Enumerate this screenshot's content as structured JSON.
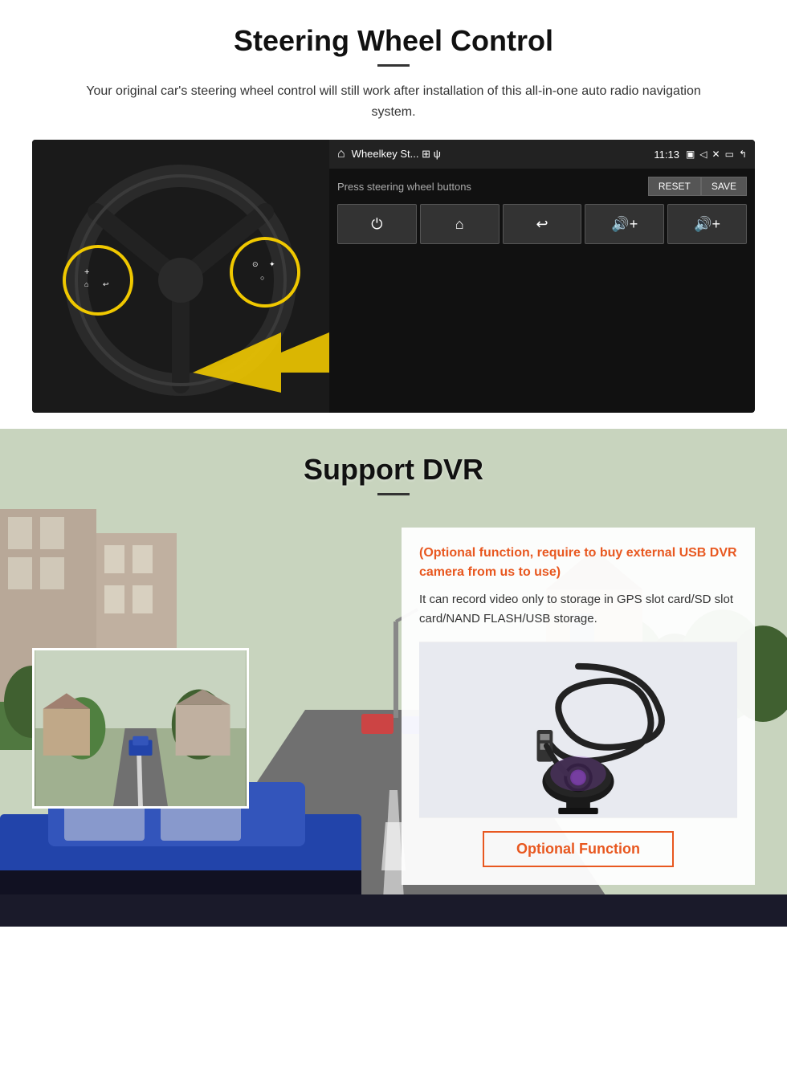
{
  "swc": {
    "title": "Steering Wheel Control",
    "subtitle": "Your original car's steering wheel control will still work after installation of this all-in-one auto radio navigation system.",
    "screen": {
      "app_title": "Wheelkey St... ⊞ ψ",
      "time": "11:13",
      "prompt": "Press steering wheel buttons",
      "reset_btn": "RESET",
      "save_btn": "SAVE",
      "control_buttons": [
        "⏻",
        "⌂",
        "↩",
        "🔊+",
        "🔊+"
      ]
    }
  },
  "dvr": {
    "title": "Support DVR",
    "optional_text": "(Optional function, require to buy external USB DVR camera from us to use)",
    "description": "It can record video only to storage in GPS slot card/SD slot card/NAND FLASH/USB storage.",
    "optional_badge": "Optional Function"
  }
}
